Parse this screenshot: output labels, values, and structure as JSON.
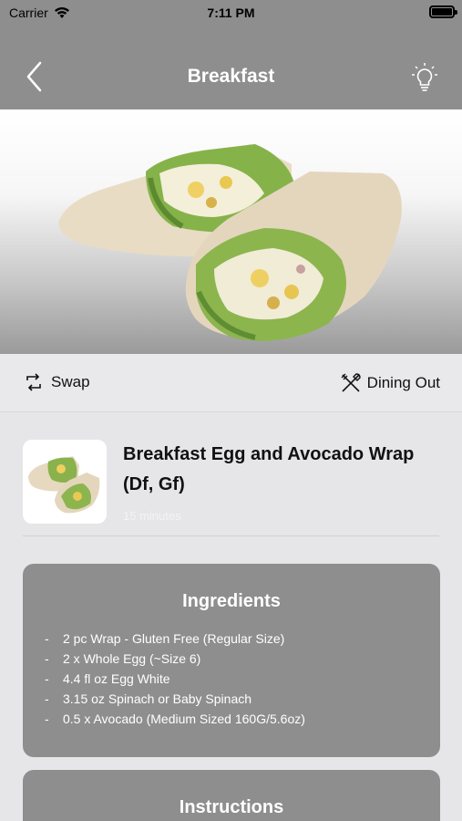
{
  "status_bar": {
    "carrier": "Carrier",
    "time": "7:11 PM"
  },
  "nav": {
    "title": "Breakfast",
    "back_icon": "chevron-left-icon",
    "tip_icon": "lightbulb-icon"
  },
  "actions": {
    "swap_label": "Swap",
    "dining_out_label": "Dining Out"
  },
  "recipe": {
    "name": "Breakfast Egg and Avocado Wrap (Df, Gf)",
    "duration": "15 minutes"
  },
  "ingredients": {
    "title": "Ingredients",
    "items": [
      "2 pc Wrap - Gluten Free (Regular Size)",
      "2 x Whole Egg (~Size 6)",
      "4.4 fl oz Egg White",
      "3.15 oz Spinach or Baby Spinach",
      "0.5 x Avocado (Medium Sized 160G/5.6oz)"
    ]
  },
  "instructions": {
    "title": "Instructions"
  },
  "colors": {
    "header_gray": "#8e8e8e",
    "background": "#e6e6e8",
    "card_gray": "#8e8e8e"
  }
}
